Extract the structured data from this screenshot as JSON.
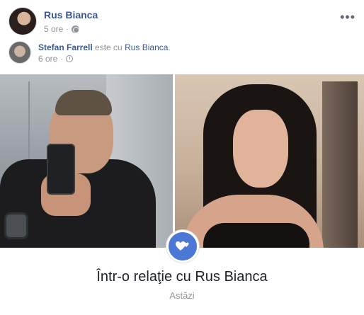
{
  "post": {
    "author_name": "Rus Bianca",
    "time": "5 ore",
    "separator": "·",
    "more_label": "•••"
  },
  "shared": {
    "user_name": "Stefan Farrell",
    "connector": " este cu ",
    "tagged_name": "Rus Bianca",
    "end": ".",
    "time": "6 ore",
    "separator": "·"
  },
  "life_event": {
    "title": "Într-o relaţie cu Rus Bianca",
    "date": "Astăzi",
    "icon": "hearts-icon"
  },
  "colors": {
    "link": "#385898",
    "meta": "#90949c",
    "badge": "#4b78d4"
  }
}
